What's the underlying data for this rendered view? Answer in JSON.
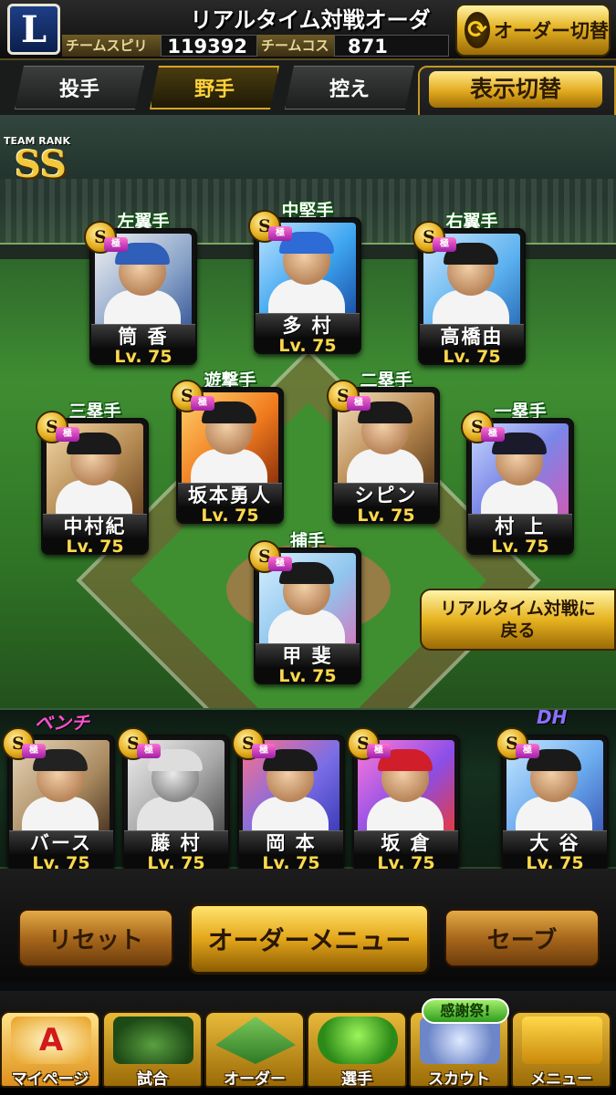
{
  "header": {
    "team_logo": "L",
    "title": "リアルタイム対戦オーダー",
    "spirits_label": "チームスピリッツ",
    "spirits_value": "119392",
    "cost_label": "チームコスト",
    "cost_value": "871",
    "order_switch_label": "オーダー切替",
    "order_switch_icon": "swap-icon"
  },
  "tabs": [
    {
      "label": "投手",
      "active": false
    },
    {
      "label": "野手",
      "active": true
    },
    {
      "label": "控え",
      "active": false
    }
  ],
  "display_toggle": {
    "title": "表示切替",
    "value": "–"
  },
  "team_rank": {
    "label": "TEAM RANK",
    "value": "SS"
  },
  "lineup": [
    {
      "position": "左翼手",
      "name": "筒 香",
      "level": "Lv. 75",
      "rank": "S",
      "cap_color": "#2f5fb8"
    },
    {
      "position": "中堅手",
      "name": "多 村",
      "level": "Lv. 75",
      "rank": "S",
      "cap_color": "#2d6bd6"
    },
    {
      "position": "右翼手",
      "name": "高橋由",
      "level": "Lv. 75",
      "rank": "S",
      "cap_color": "#1a1a1a"
    },
    {
      "position": "遊撃手",
      "name": "坂本勇人",
      "level": "Lv. 75",
      "rank": "S",
      "cap_color": "#1a1a1a"
    },
    {
      "position": "二塁手",
      "name": "シピン",
      "level": "Lv. 75",
      "rank": "S",
      "cap_color": "#1a1a1a"
    },
    {
      "position": "三塁手",
      "name": "中村紀",
      "level": "Lv. 75",
      "rank": "S",
      "cap_color": "#1a1a1a"
    },
    {
      "position": "一塁手",
      "name": "村 上",
      "level": "Lv. 75",
      "rank": "S",
      "cap_color": "#1a1a2a"
    },
    {
      "position": "捕手",
      "name": "甲 斐",
      "level": "Lv. 75",
      "rank": "S",
      "cap_color": "#1a1a1a"
    }
  ],
  "bench_label": "ベンチ",
  "dh_label": "DH",
  "bench": [
    {
      "name": "バース",
      "level": "Lv. 75",
      "rank": "S",
      "cap_color": "#222222"
    },
    {
      "name": "藤 村",
      "level": "Lv. 75",
      "rank": "S",
      "cap_color": "#dddddd"
    },
    {
      "name": "岡 本",
      "level": "Lv. 75",
      "rank": "S",
      "cap_color": "#1a1a1a"
    },
    {
      "name": "坂 倉",
      "level": "Lv. 75",
      "rank": "S",
      "cap_color": "#d01e2a"
    }
  ],
  "dh": {
    "name": "大 谷",
    "level": "Lv. 75",
    "rank": "S",
    "cap_color": "#1a1a1a"
  },
  "return_button": {
    "line1": "リアルタイム対戦に",
    "line2": "戻る"
  },
  "actions": {
    "reset": "リセット",
    "menu": "オーダーメニュー",
    "save": "セーブ"
  },
  "nav": [
    {
      "label": "マイページ",
      "icon": "home-a-icon",
      "glyph": "A"
    },
    {
      "label": "試合",
      "icon": "stadium-icon",
      "glyph": ""
    },
    {
      "label": "オーダー",
      "icon": "field-icon",
      "glyph": ""
    },
    {
      "label": "選手",
      "icon": "player-icon",
      "glyph": ""
    },
    {
      "label": "スカウト",
      "icon": "scout-icon",
      "glyph": ""
    },
    {
      "label": "メニュー",
      "icon": "menu-icon",
      "glyph": ""
    }
  ],
  "nav_badge": "感謝祭!",
  "colors": {
    "accent_gold": "#e5b221",
    "position_green": "#114d14",
    "level_yellow": "#ffd94a",
    "bench_pink": "#ff4fd0",
    "dh_purple": "#7a5cff"
  }
}
